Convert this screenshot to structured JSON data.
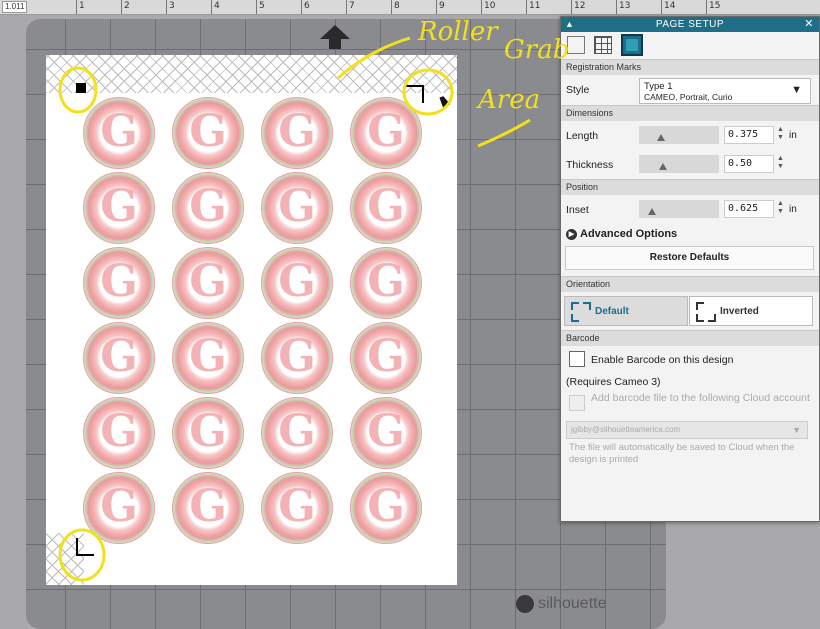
{
  "ruler": {
    "coord": "1.011",
    "numbers": [
      "1",
      "2",
      "3",
      "4",
      "5",
      "6",
      "7",
      "8",
      "9",
      "10",
      "11",
      "12",
      "13",
      "14",
      "15"
    ]
  },
  "mat": {
    "brand": "silhouette"
  },
  "design": {
    "letter": "G",
    "rows": 6,
    "cols": 4
  },
  "annotation": {
    "words": [
      "Roller",
      "Grab",
      "Area"
    ],
    "color": "#f4e01a"
  },
  "panel": {
    "title": "PAGE SETUP",
    "close": "✕",
    "sections": {
      "registration": "Registration Marks",
      "dimensions": "Dimensions",
      "position": "Position",
      "orientation": "Orientation",
      "barcode": "Barcode"
    },
    "style_label": "Style",
    "style_value": "Type 1",
    "style_sub": "CAMEO, Portrait, Curio",
    "length_label": "Length",
    "length_value": "0.375",
    "length_fraction": 0.25,
    "thickness_label": "Thickness",
    "thickness_value": "0.50",
    "thickness_fraction": 0.28,
    "inset_label": "Inset",
    "inset_value": "0.625",
    "inset_fraction": 0.12,
    "unit": "in",
    "advanced": "Advanced Options",
    "restore": "Restore Defaults",
    "orient_default": "Default",
    "orient_inverted": "Inverted",
    "barcode_enable": "Enable Barcode on this design",
    "requires": "(Requires Cameo 3)",
    "add_barcode": "Add barcode file to the following Cloud account",
    "email": "jgibby@silhouetteamerica.com",
    "note": "The file will automatically be saved to Cloud when the design is printed",
    "accent": "#1f6e88"
  }
}
